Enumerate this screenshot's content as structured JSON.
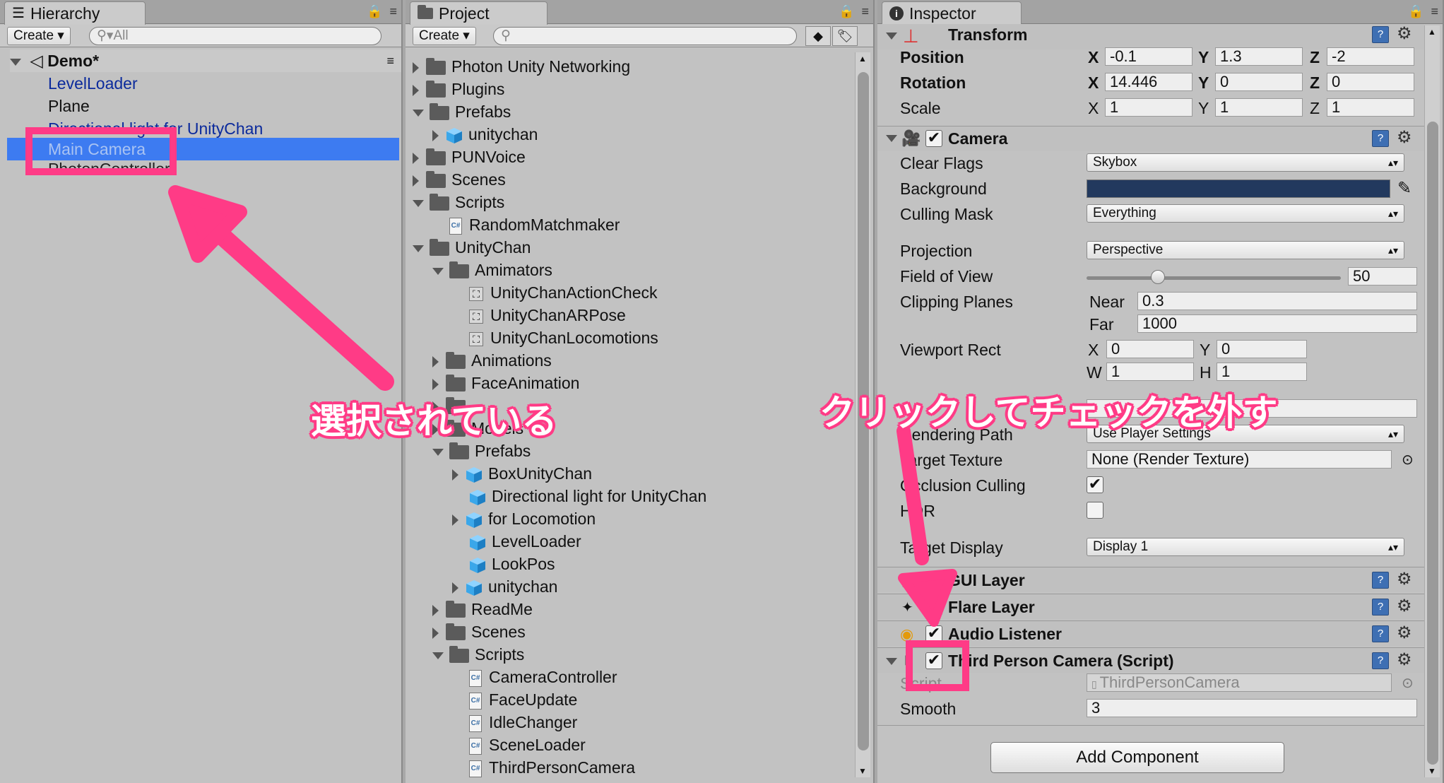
{
  "hierarchy": {
    "tab_label": "Hierarchy",
    "create_label": "Create",
    "search_placeholder": "All",
    "scene_name": "Demo*",
    "items": [
      "LevelLoader",
      "Plane",
      "Directional light for UnityChan",
      "Main Camera",
      "PhotonController"
    ]
  },
  "project": {
    "tab_label": "Project",
    "create_label": "Create",
    "items": [
      "Photon Unity Networking",
      "Plugins",
      "Prefabs",
      "unitychan",
      "PUNVoice",
      "Scenes",
      "Scripts",
      "RandomMatchmaker",
      "UnityChan",
      "Amimators",
      "UnityChanActionCheck",
      "UnityChanARPose",
      "UnityChanLocomotions",
      "Animations",
      "FaceAnimation",
      "",
      "Models",
      "Prefabs",
      "BoxUnityChan",
      "Directional light for UnityChan",
      "for Locomotion",
      "LevelLoader",
      "LookPos",
      "unitychan",
      "ReadMe",
      "Scenes",
      "Scripts",
      "CameraController",
      "FaceUpdate",
      "IdleChanger",
      "SceneLoader",
      "ThirdPersonCamera"
    ]
  },
  "inspector": {
    "tab_label": "Inspector",
    "transform": {
      "title": "Transform",
      "position_label": "Position",
      "rotation_label": "Rotation",
      "scale_label": "Scale",
      "x": "X",
      "y": "Y",
      "z": "Z",
      "position": [
        "-0.1",
        "1.3",
        "-2"
      ],
      "rotation": [
        "14.446",
        "0",
        "0"
      ],
      "scale": [
        "1",
        "1",
        "1"
      ]
    },
    "camera": {
      "title": "Camera",
      "clear_flags_label": "Clear Flags",
      "clear_flags": "Skybox",
      "background_label": "Background",
      "background_color": "#22395e",
      "culling_mask_label": "Culling Mask",
      "culling_mask": "Everything",
      "projection_label": "Projection",
      "projection": "Perspective",
      "fov_label": "Field of View",
      "fov": "50",
      "fov_fraction": 0.28,
      "clipping_label": "Clipping Planes",
      "near_label": "Near",
      "near": "0.3",
      "far_label": "Far",
      "far": "1000",
      "viewport_label": "Viewport Rect",
      "vx_label": "X",
      "vx": "0",
      "vy_label": "Y",
      "vy": "0",
      "vw_label": "W",
      "vw": "1",
      "vh_label": "H",
      "vh": "1",
      "rendering_label": "Rendering Path",
      "rendering": "Use Player Settings",
      "target_label": "Target Texture",
      "target": "None (Render Texture)",
      "occlusion_label": "Occlusion Culling",
      "occlusion": true,
      "hdr_label": "HDR",
      "hdr": false,
      "display_label": "Target Display",
      "display": "Display 1"
    },
    "components": {
      "gui_layer": "GUI Layer",
      "flare_layer": "Flare Layer",
      "audio_listener": "Audio Listener",
      "third_person": "Third Person Camera (Script)",
      "script_label": "Script",
      "script_value": "ThirdPersonCamera",
      "smooth_label": "Smooth",
      "smooth_value": "3"
    },
    "add_component": "Add Component"
  },
  "annotations": {
    "selected": "選択されている",
    "uncheck": "クリックしてチェックを外す",
    "accent": "#ff3b86"
  }
}
